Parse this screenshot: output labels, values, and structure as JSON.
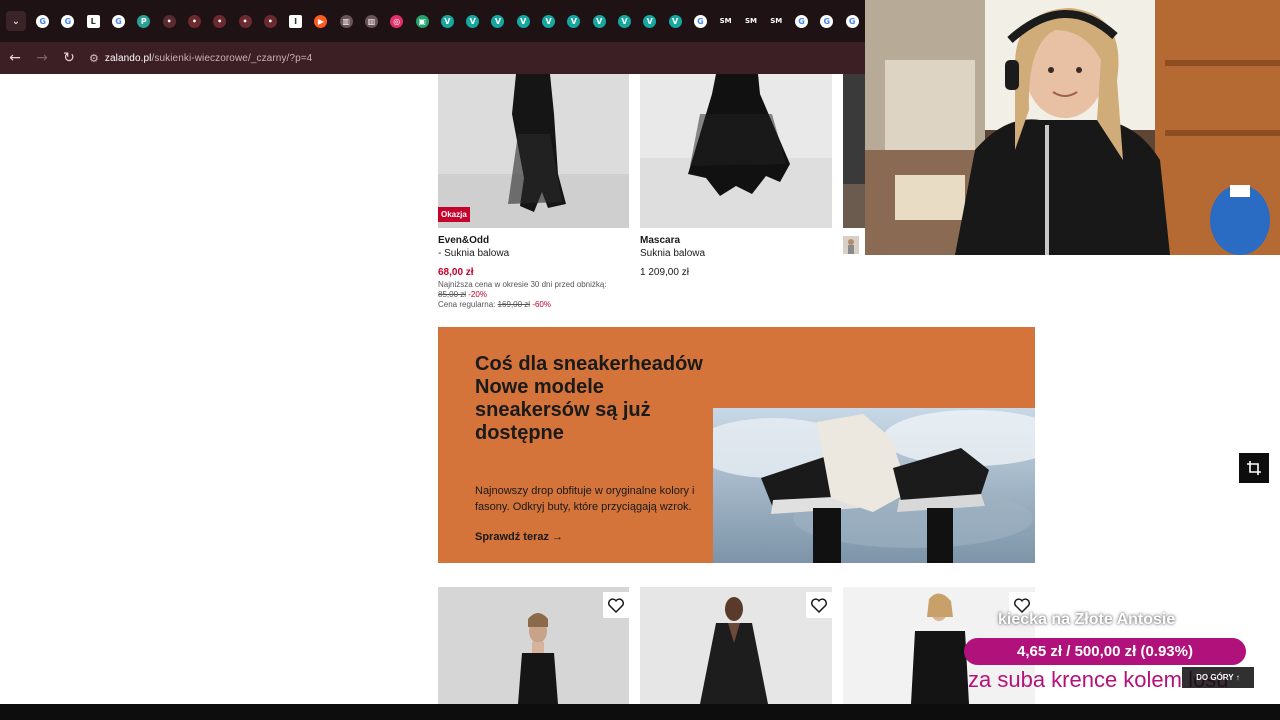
{
  "browser": {
    "url_host": "zalando.pl",
    "url_path": "/sukienki-wieczorowe/_czarny/?p=4",
    "tabs": [
      {
        "icon": "google-icon",
        "color": "#ffffff",
        "glyph": "G"
      },
      {
        "icon": "google-icon",
        "color": "#ffffff",
        "glyph": "G"
      },
      {
        "icon": "letter-l-icon",
        "color": "#ffffff",
        "glyph": "L"
      },
      {
        "icon": "google-icon",
        "color": "#ffffff",
        "glyph": "G"
      },
      {
        "icon": "pin-icon",
        "color": "#2aa198",
        "glyph": "P"
      },
      {
        "icon": "dim-icon",
        "color": "#5a2a30",
        "glyph": "•"
      },
      {
        "icon": "dim-icon",
        "color": "#6b2a30",
        "glyph": "•"
      },
      {
        "icon": "dim-icon",
        "color": "#6b2a30",
        "glyph": "•"
      },
      {
        "icon": "dim-icon",
        "color": "#6b2a30",
        "glyph": "•"
      },
      {
        "icon": "dim-icon",
        "color": "#6b2a30",
        "glyph": "•"
      },
      {
        "icon": "letter-i-icon",
        "color": "#ffffff",
        "glyph": "I"
      },
      {
        "icon": "play-icon",
        "color": "#ff5a1f",
        "glyph": "▶"
      },
      {
        "icon": "grid-icon",
        "color": "#6a5458",
        "glyph": "▥"
      },
      {
        "icon": "grid-icon",
        "color": "#6a5458",
        "glyph": "▥"
      },
      {
        "icon": "instagram-icon",
        "color": "#e1306c",
        "glyph": "◎"
      },
      {
        "icon": "app-icon",
        "color": "#23a36b",
        "glyph": "▣"
      },
      {
        "icon": "v-icon",
        "color": "#16a7a0",
        "glyph": "V"
      },
      {
        "icon": "v-icon",
        "color": "#16a7a0",
        "glyph": "V"
      },
      {
        "icon": "v-icon",
        "color": "#16a7a0",
        "glyph": "V"
      },
      {
        "icon": "v-icon",
        "color": "#16a7a0",
        "glyph": "V"
      },
      {
        "icon": "v-icon",
        "color": "#16a7a0",
        "glyph": "V"
      },
      {
        "icon": "v-icon",
        "color": "#16a7a0",
        "glyph": "V"
      },
      {
        "icon": "v-icon",
        "color": "#16a7a0",
        "glyph": "V"
      },
      {
        "icon": "v-icon",
        "color": "#16a7a0",
        "glyph": "V"
      },
      {
        "icon": "v-icon",
        "color": "#16a7a0",
        "glyph": "V"
      },
      {
        "icon": "v-icon",
        "color": "#16a7a0",
        "glyph": "V"
      },
      {
        "icon": "google-icon",
        "color": "#ffffff",
        "glyph": "G"
      },
      {
        "icon": "sm-icon",
        "color": "#2b2b2b",
        "glyph": "SM"
      },
      {
        "icon": "sm-icon",
        "color": "#2b2b2b",
        "glyph": "SM"
      },
      {
        "icon": "sm-icon",
        "color": "#2b2b2b",
        "glyph": "SM"
      },
      {
        "icon": "google-icon",
        "color": "#ffffff",
        "glyph": "G"
      },
      {
        "icon": "google-icon",
        "color": "#ffffff",
        "glyph": "G"
      },
      {
        "icon": "google-icon",
        "color": "#ffffff",
        "glyph": "G"
      }
    ]
  },
  "products_top": [
    {
      "badge": "Okazja",
      "brand": "Even&Odd",
      "name": "- Suknia balowa",
      "price": "68,00 zł",
      "lowest_label": "Najniższa cena w okresie 30 dni przed obniżką:",
      "lowest_price": "85,00 zł",
      "lowest_discount": "-20%",
      "regular_label": "Cena regularna:",
      "regular_price": "169,00 zł",
      "regular_discount": "-60%"
    },
    {
      "brand": "Mascara",
      "name": "Suknia balowa",
      "price": "1 209,00 zł"
    }
  ],
  "banner": {
    "title": "Coś dla sneakerheadów Nowe modele sneakersów są już dostępne",
    "description": "Najnowszy drop obfituje w oryginalne kolory i fasony. Odkryj buty, które przyciągają wzrok.",
    "cta": "Sprawdź teraz",
    "bg_color": "#d4733a"
  },
  "overlay": {
    "goal_title": "kiecka na Złote Antosie",
    "goal_progress": "4,65 zł / 500,00 zł (0.93%)",
    "goal_note": "za suba krence kolem losu",
    "dogory": "DO GÓRY"
  },
  "colors": {
    "brand_red": "#c4002b",
    "tabstrip": "#1f1214",
    "addrbar": "#3c1f24",
    "goal_magenta": "#b1117a"
  }
}
